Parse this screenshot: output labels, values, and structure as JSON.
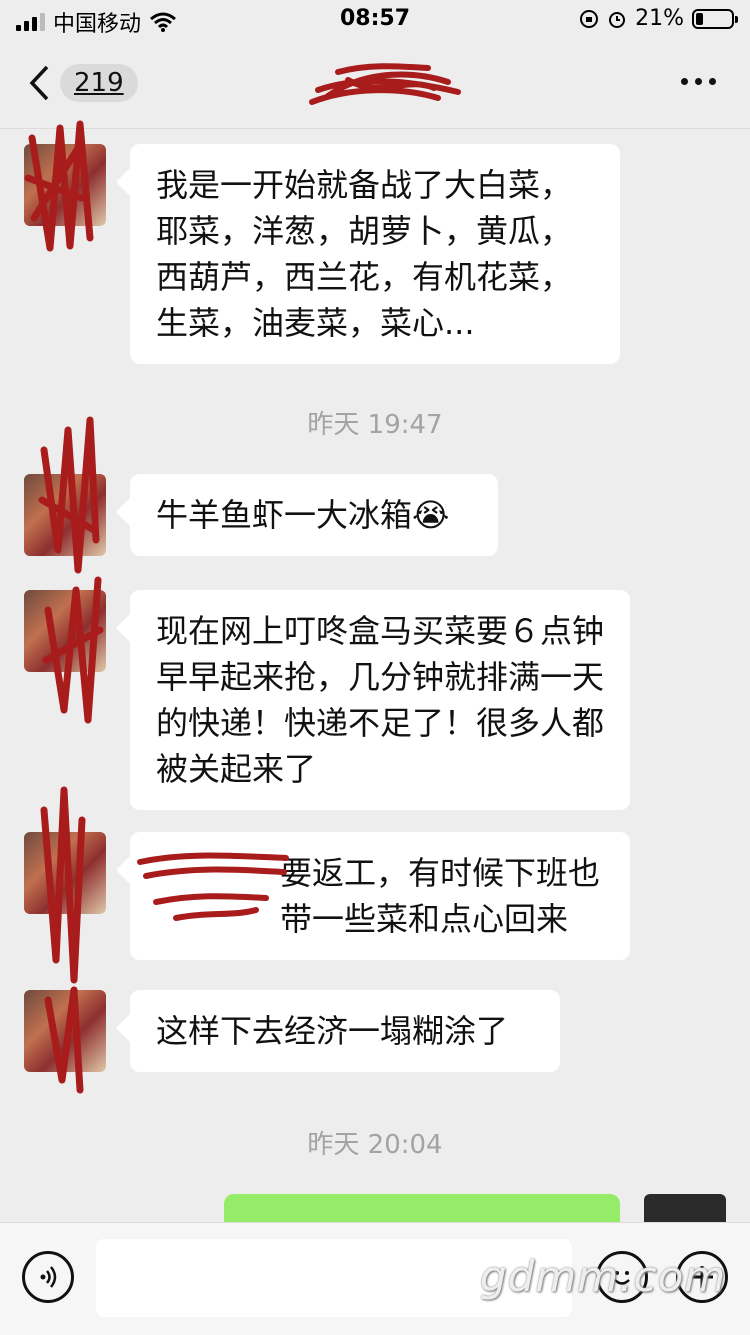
{
  "status_bar": {
    "carrier": "中国移动",
    "time": "08:57",
    "battery_percent": "21%",
    "battery_level": 0.21
  },
  "nav": {
    "unread_count": "219",
    "title": ""
  },
  "messages": [
    {
      "text": "我是一开始就备战了大白菜，耶菜，洋葱，胡萝卜，黄瓜，西葫芦，西兰花，有机花菜，生菜，油麦菜，菜心..."
    },
    {
      "text": "牛羊鱼虾一大冰箱😭"
    },
    {
      "text": "现在网上叮咚盒马买菜要６点钟早早起来抢，几分钟就排满一天的快递！快递不足了！很多人都被关起来了"
    },
    {
      "text": "要返工，有时候下班也带一些菜和点心回来"
    },
    {
      "text": "这样下去经济一塌糊涂了"
    }
  ],
  "timestamps": [
    "昨天 19:47",
    "昨天 20:04"
  ],
  "input": {
    "placeholder": ""
  },
  "watermark": "gdmm.com",
  "icons": [
    "back-chevron-icon",
    "more-dots-icon",
    "voice-icon",
    "emoji-icon",
    "plus-icon",
    "wifi-icon",
    "signal-icon",
    "battery-icon",
    "orientation-lock-icon",
    "alarm-icon"
  ],
  "colors": {
    "background": "#ededed",
    "bubble_in": "#ffffff",
    "bubble_out": "#95ec69",
    "timestamp": "#a3a3a3",
    "redaction": "#a81c1c"
  }
}
